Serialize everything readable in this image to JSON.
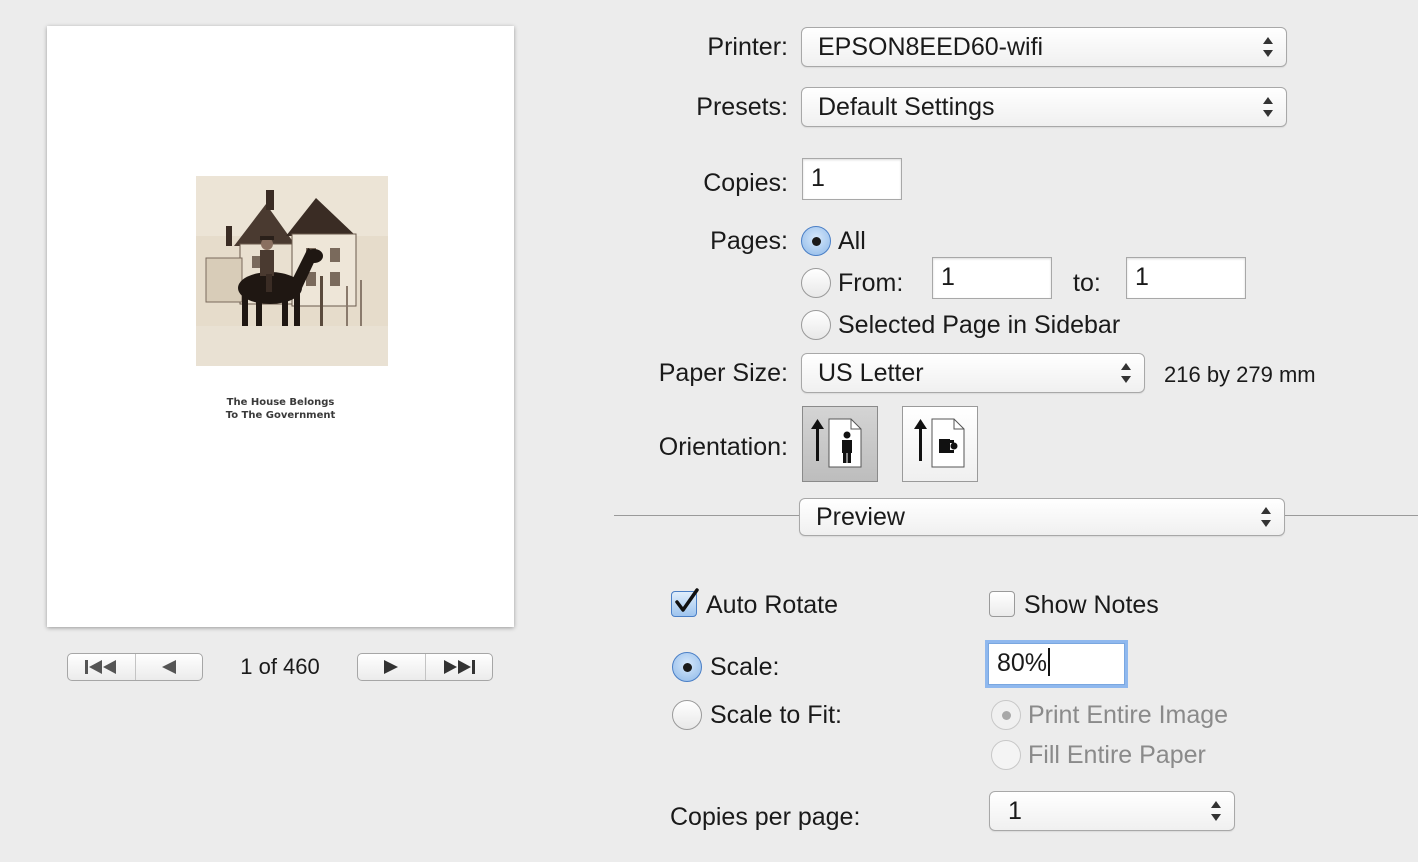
{
  "preview": {
    "caption_line1": "The House Belongs",
    "caption_line2": "To The Government",
    "page_indicator": "1 of 460"
  },
  "printer": {
    "label": "Printer:",
    "value": "EPSON8EED60-wifi"
  },
  "presets": {
    "label": "Presets:",
    "value": "Default Settings"
  },
  "copies": {
    "label": "Copies:",
    "value": "1"
  },
  "pages": {
    "label": "Pages:",
    "all_label": "All",
    "from_label": "From:",
    "from_value": "1",
    "to_label": "to:",
    "to_value": "1",
    "selected_label": "Selected Page in Sidebar",
    "selected_option": "All"
  },
  "paper_size": {
    "label": "Paper Size:",
    "value": "US Letter",
    "dimensions": "216 by 279 mm"
  },
  "orientation": {
    "label": "Orientation:",
    "selected": "portrait"
  },
  "section_menu": {
    "value": "Preview"
  },
  "preview_options": {
    "auto_rotate_label": "Auto Rotate",
    "auto_rotate_checked": true,
    "show_notes_label": "Show Notes",
    "show_notes_checked": false,
    "scale_label": "Scale:",
    "scale_value": "80%",
    "scale_to_fit_label": "Scale to Fit:",
    "print_entire_image_label": "Print Entire Image",
    "fill_entire_paper_label": "Fill Entire Paper",
    "selected_scale_mode": "Scale"
  },
  "copies_per_page": {
    "label": "Copies per page:",
    "value": "1"
  },
  "colors": {
    "focus_ring": "#8fb8ee",
    "radio_selected": "#8db8e8",
    "window_bg": "#ececec"
  }
}
